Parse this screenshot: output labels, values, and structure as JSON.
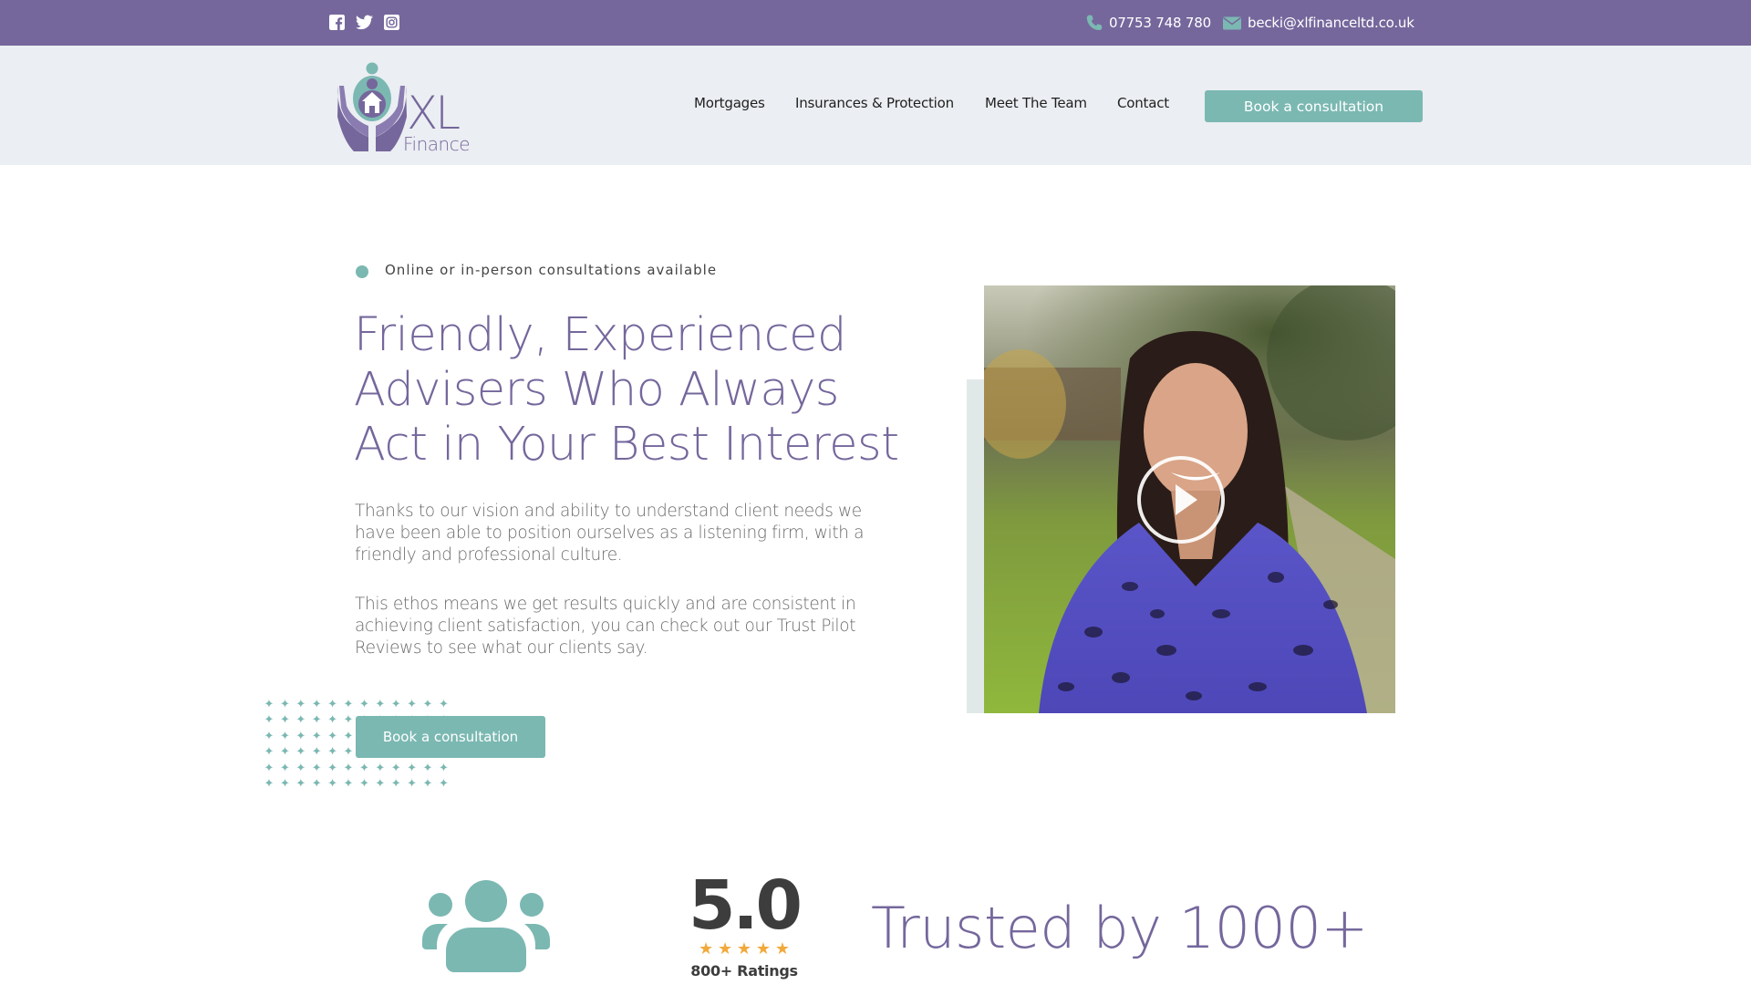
{
  "topbar": {
    "social": [
      {
        "name": "facebook-icon",
        "label": "Facebook"
      },
      {
        "name": "twitter-icon",
        "label": "Twitter"
      },
      {
        "name": "instagram-icon",
        "label": "Instagram"
      }
    ],
    "phone": "07753 748 780",
    "email": "becki@xlfinanceltd.co.uk"
  },
  "header": {
    "logo": {
      "line1": "XL",
      "line2": "Finance"
    },
    "nav": [
      {
        "label": "Mortgages"
      },
      {
        "label": "Insurances & Protection"
      },
      {
        "label": "Meet The Team"
      },
      {
        "label": "Contact"
      }
    ],
    "cta_label": "Book a consultation"
  },
  "hero": {
    "badge": "Online or in-person consultations available",
    "title_lines": [
      "Friendly, Experienced",
      "Advisers Who Always",
      "Act in Your Best Interest"
    ],
    "paragraphs": [
      "Thanks to our vision and ability to understand client needs we have been able to position ourselves as a listening firm, with a friendly and professional culture.",
      "This ethos means we get results quickly and are consistent in achieving client satisfaction, you can check out our Trust Pilot Reviews to see what our clients say."
    ],
    "cta_label": "Book a consultation",
    "video": {
      "play_icon": "play-icon"
    }
  },
  "stats": {
    "rating_value": "5.0",
    "rating_stars": 5,
    "star_glyph": "★",
    "ratings_count": "800+ Ratings",
    "trusted_text": "Trusted by 1000+"
  },
  "colors": {
    "brand_purple": "#75679c",
    "brand_teal": "#7bb8b2",
    "header_bg": "#ebeef2",
    "star": "#f2a93b",
    "accent_bar": "#e1e8e8"
  }
}
